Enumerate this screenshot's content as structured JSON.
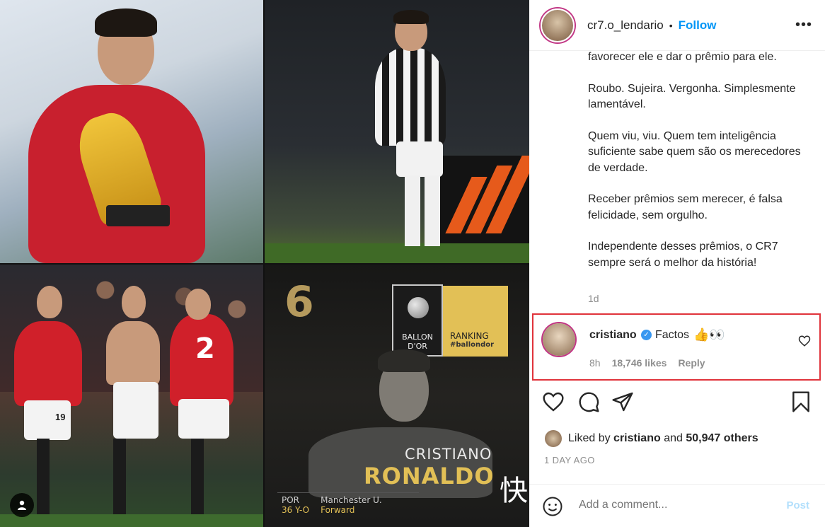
{
  "post": {
    "username": "cr7.o_lendario",
    "separator": "•",
    "follow_label": "Follow",
    "more_label": "•••"
  },
  "images": {
    "ballon": {
      "rank": "6",
      "logo_text": "BALLON\nD'OR",
      "ranking_label": "RANKING",
      "ranking_tag": "#ballondor",
      "first_name": "CRISTIANO",
      "last_name": "RONALDO",
      "position_label": "POR",
      "age": "36 Y-O",
      "club": "Manchester U.",
      "role": "Forward"
    },
    "shirt_numbers": [
      "2",
      "19"
    ],
    "watermark": "快"
  },
  "caption": {
    "paragraphs": [
      "favorecer ele e dar o prêmio para ele.",
      "Roubo. Sujeira. Vergonha. Simplesmente lamentável.",
      "Quem viu, viu. Quem tem inteligência suficiente sabe quem são os merecedores de verdade.",
      "Receber prêmios sem merecer, é falsa felicidade, sem orgulho.",
      "Independente desses prêmios, o CR7 sempre será o melhor da história!"
    ],
    "time": "1d"
  },
  "highlighted_comment": {
    "username": "cristiano",
    "text": "Factos",
    "emoji": "👍👀",
    "time": "8h",
    "likes": "18,746 likes",
    "reply_label": "Reply"
  },
  "likes": {
    "prefix": "Liked by",
    "user": "cristiano",
    "conjunction": "and",
    "others": "50,947 others"
  },
  "post_age": "1 DAY AGO",
  "add_comment": {
    "placeholder": "Add a comment...",
    "post_label": "Post"
  },
  "colors": {
    "accent": "#0095f6",
    "highlight_border": "#e0333b",
    "muted": "#8e8e8e"
  }
}
